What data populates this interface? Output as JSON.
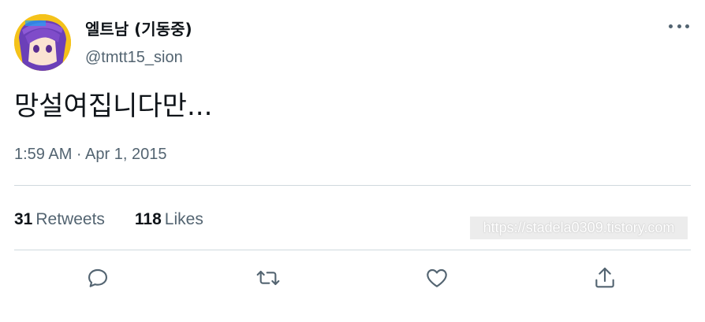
{
  "author": {
    "display_name": "엘트남 (기동중)",
    "handle": "@tmtt15_sion",
    "avatar_icon": "anime-avatar-icon"
  },
  "tweet": {
    "text": "망설여집니다만...",
    "timestamp": "1:59 AM · Apr 1, 2015"
  },
  "stats": {
    "retweets_count": "31",
    "retweets_label": "Retweets",
    "likes_count": "118",
    "likes_label": "Likes"
  },
  "watermark": "https://stadela0309.tistory.com",
  "actions": [
    "reply-icon",
    "retweet-icon",
    "like-icon",
    "share-icon"
  ],
  "colors": {
    "primary_text": "#0f1419",
    "secondary_text": "#536471",
    "divider": "#cfd9de"
  }
}
